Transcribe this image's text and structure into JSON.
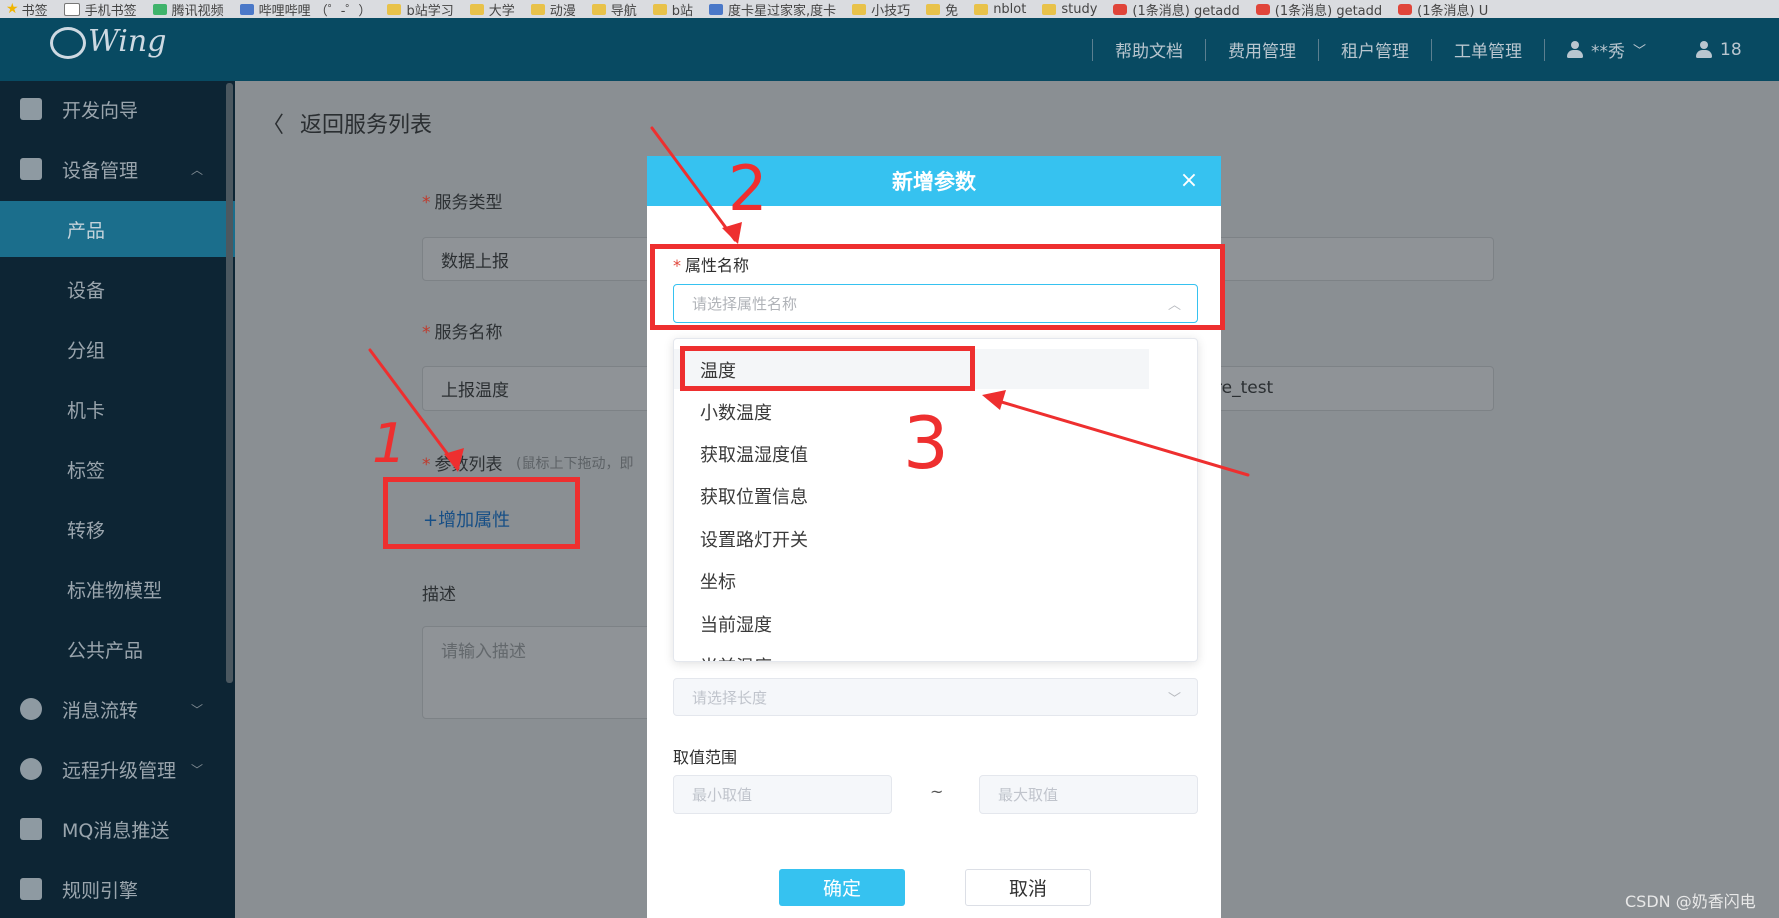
{
  "bookmarks": [
    {
      "icon": "star-icon",
      "label": "书签"
    },
    {
      "icon": "page-icon",
      "label": "手机书签"
    },
    {
      "icon": "video-icon",
      "label": "腾讯视频"
    },
    {
      "icon": "bilibili-icon",
      "label": "哔哩哔哩 （゜-゜）"
    },
    {
      "icon": "folder-icon",
      "label": "b站学习"
    },
    {
      "icon": "folder-icon",
      "label": "大学"
    },
    {
      "icon": "folder-icon",
      "label": "动漫"
    },
    {
      "icon": "folder-icon",
      "label": "导航"
    },
    {
      "icon": "folder-icon",
      "label": "b站"
    },
    {
      "icon": "blue-page-icon",
      "label": "度卡星过家家,度卡"
    },
    {
      "icon": "folder-icon",
      "label": "小技巧"
    },
    {
      "icon": "folder-icon",
      "label": "免"
    },
    {
      "icon": "folder-icon",
      "label": "nblot"
    },
    {
      "icon": "folder-icon",
      "label": "study"
    },
    {
      "icon": "csdn-icon",
      "label": "(1条消息) getadd"
    },
    {
      "icon": "csdn-icon",
      "label": "(1条消息) getadd"
    },
    {
      "icon": "csdn-icon",
      "label": "(1条消息) U"
    }
  ],
  "header": {
    "logo_text": "Wing",
    "nav": [
      "帮助文档",
      "费用管理",
      "租户管理",
      "工单管理"
    ],
    "user_name": "**秀",
    "user2_text": "18"
  },
  "sidebar": {
    "items": [
      {
        "label": "开发向导"
      },
      {
        "label": "设备管理"
      },
      {
        "label": "产品"
      },
      {
        "label": "设备"
      },
      {
        "label": "分组"
      },
      {
        "label": "机卡"
      },
      {
        "label": "标签"
      },
      {
        "label": "转移"
      },
      {
        "label": "标准物模型"
      },
      {
        "label": "公共产品"
      },
      {
        "label": "消息流转"
      },
      {
        "label": "远程升级管理"
      },
      {
        "label": "MQ消息推送"
      },
      {
        "label": "规则引擎"
      }
    ]
  },
  "page": {
    "back_label": "返回服务列表",
    "service_type_label": "服务类型",
    "service_type_value": "数据上报",
    "service_name_label": "服务名称",
    "service_name_value": "上报温度",
    "service_identifier_value": "re_test",
    "param_list_label": "参数列表",
    "param_list_hint": "(鼠标上下拖动，即",
    "add_property_label": "+增加属性",
    "desc_label": "描述",
    "desc_placeholder": "请输入描述"
  },
  "modal": {
    "title": "新增参数",
    "close": "×",
    "property_name_label": "属性名称",
    "property_name_placeholder": "请选择属性名称",
    "dropdown_options": [
      "温度",
      "小数温度",
      "获取温湿度值",
      "获取位置信息",
      "设置路灯开关",
      "坐标",
      "当前湿度",
      "当前温度"
    ],
    "length_placeholder": "请选择长度",
    "range_label": "取值范围",
    "min_placeholder": "最小取值",
    "range_sep": "~",
    "max_placeholder": "最大取值",
    "confirm_label": "确定",
    "cancel_label": "取消"
  },
  "annotations": [
    "1",
    "2",
    "3"
  ],
  "watermark": "CSDN @奶香闪电",
  "colors": {
    "accent": "#36c2f0",
    "header": "#084a62",
    "sidebar": "#0d2534",
    "annotation": "#ee2f2f"
  }
}
